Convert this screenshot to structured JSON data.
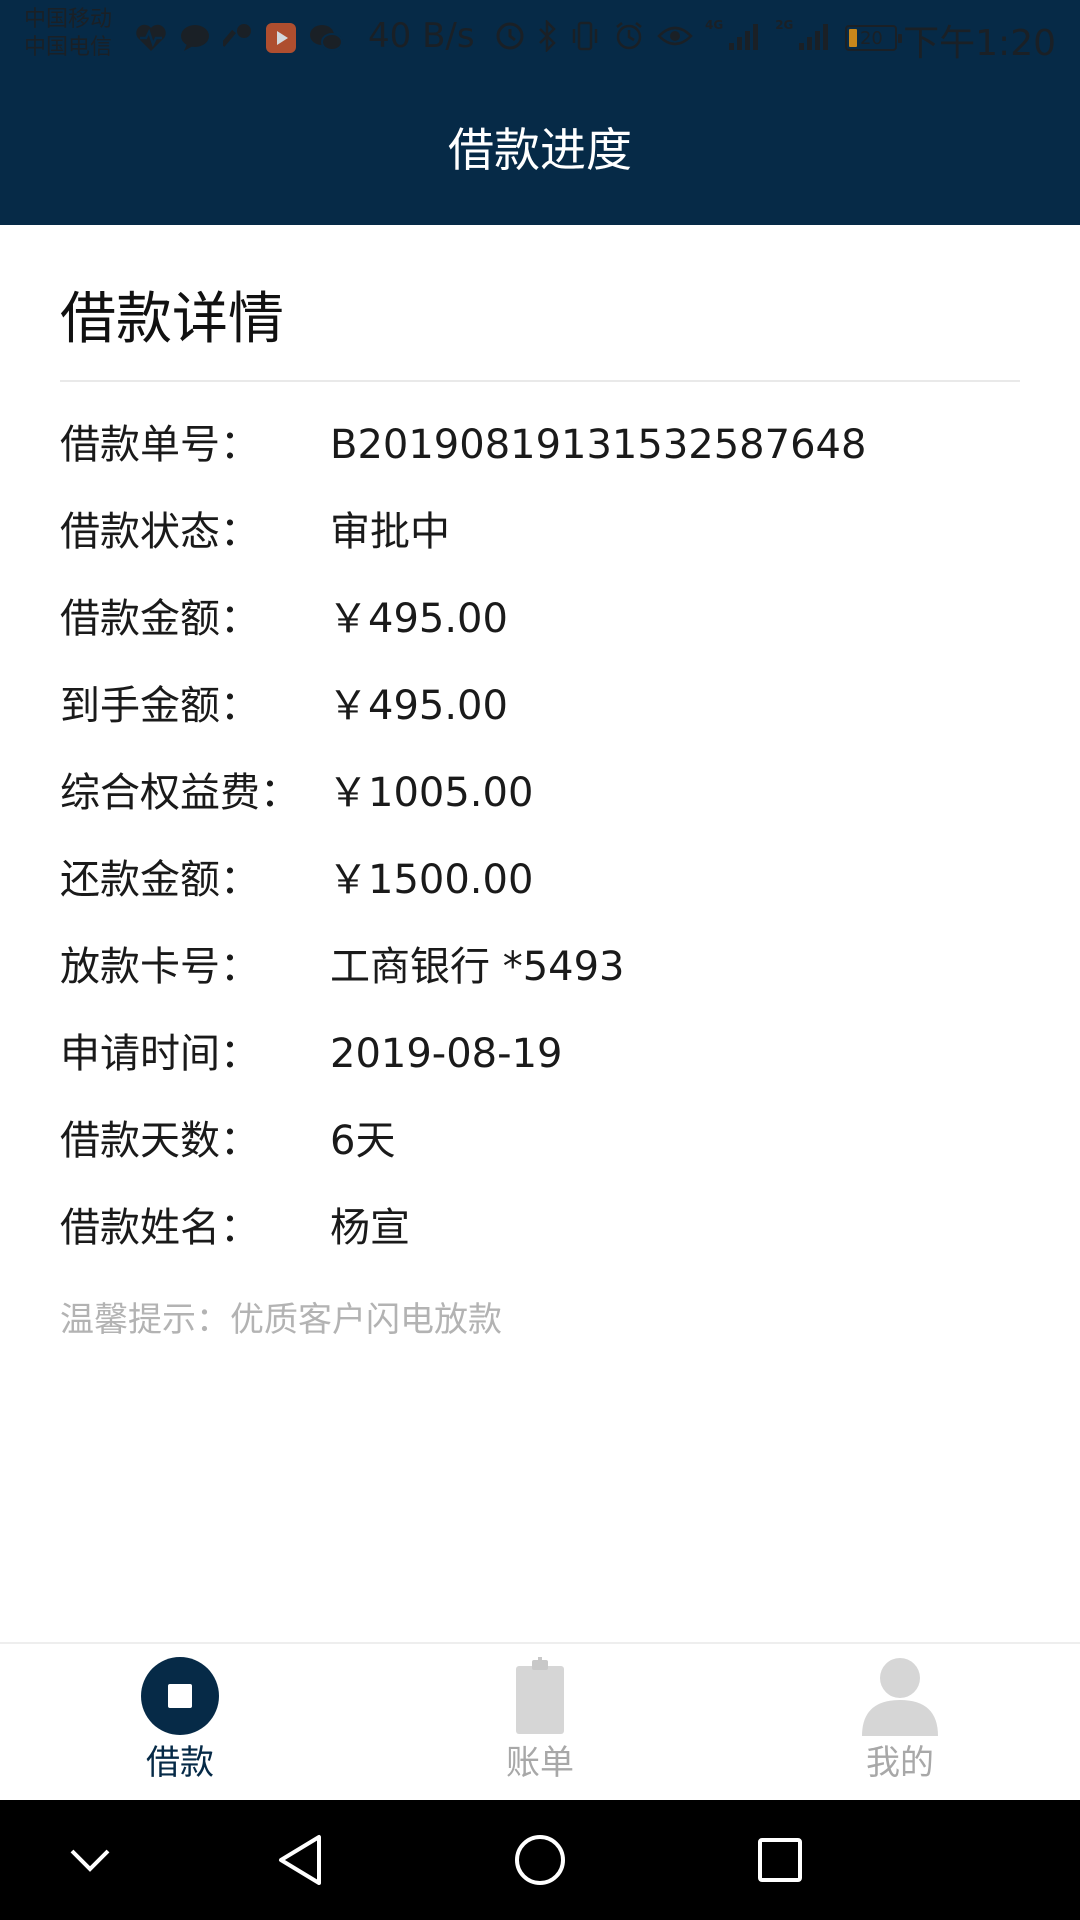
{
  "status_bar": {
    "carrier_1": "中国移动",
    "carrier_2": "中国电信",
    "net_speed": "40 B/s",
    "signal_1_label": "4G",
    "signal_2_label": "2G",
    "battery_level": "20",
    "time": "下午1:20"
  },
  "header": {
    "title": "借款进度",
    "background_color": "#062a47"
  },
  "detail": {
    "section_title": "借款详情",
    "rows": [
      {
        "label": "借款单号：",
        "value": "B20190819131532587648"
      },
      {
        "label": "借款状态：",
        "value": "审批中"
      },
      {
        "label": "借款金额：",
        "value": "￥495.00"
      },
      {
        "label": "到手金额：",
        "value": "￥495.00"
      },
      {
        "label": "综合权益费：",
        "value": "￥1005.00"
      },
      {
        "label": "还款金额：",
        "value": "￥1500.00"
      },
      {
        "label": "放款卡号：",
        "value": "工商银行 *5493"
      },
      {
        "label": "申请时间：",
        "value": "2019-08-19"
      },
      {
        "label": "借款天数：",
        "value": "6天"
      },
      {
        "label": "借款姓名：",
        "value": "杨宣"
      }
    ],
    "tip": "温馨提示：优质客户闪电放款"
  },
  "tabbar": {
    "tabs": [
      {
        "label": "借款",
        "icon": "loan-icon",
        "active": true
      },
      {
        "label": "账单",
        "icon": "bill-icon",
        "active": false
      },
      {
        "label": "我的",
        "icon": "profile-icon",
        "active": false
      }
    ],
    "active_color": "#062a47",
    "inactive_color": "#a8a8a8"
  },
  "navbar": {
    "buttons": [
      "collapse-icon",
      "back-icon",
      "home-icon",
      "recents-icon"
    ]
  }
}
